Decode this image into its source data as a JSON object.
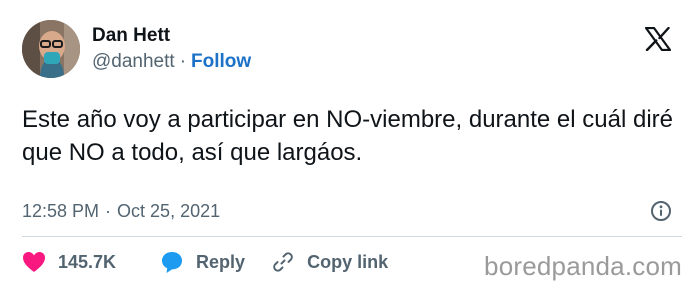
{
  "author": {
    "name": "Dan Hett",
    "handle": "@danhett",
    "separator": "·",
    "follow_label": "Follow"
  },
  "brand_icon": "x-logo-icon",
  "tweet": {
    "text": "Este año voy a participar en NO-viembre, durante el cuál diré que NO a todo, así que largáos."
  },
  "meta": {
    "time": "12:58 PM",
    "separator": "·",
    "date": "Oct 25, 2021"
  },
  "actions": {
    "like_count": "145.7K",
    "reply_label": "Reply",
    "copy_link_label": "Copy link"
  },
  "watermark": "boredpanda.com",
  "colors": {
    "text": "#0f1419",
    "secondary_text": "#536471",
    "follow_link": "#1d72c7",
    "heart": "#f91880",
    "reply_bubble": "#1d9bf0",
    "divider": "#cfd9de",
    "watermark": "#9a9a9a"
  }
}
